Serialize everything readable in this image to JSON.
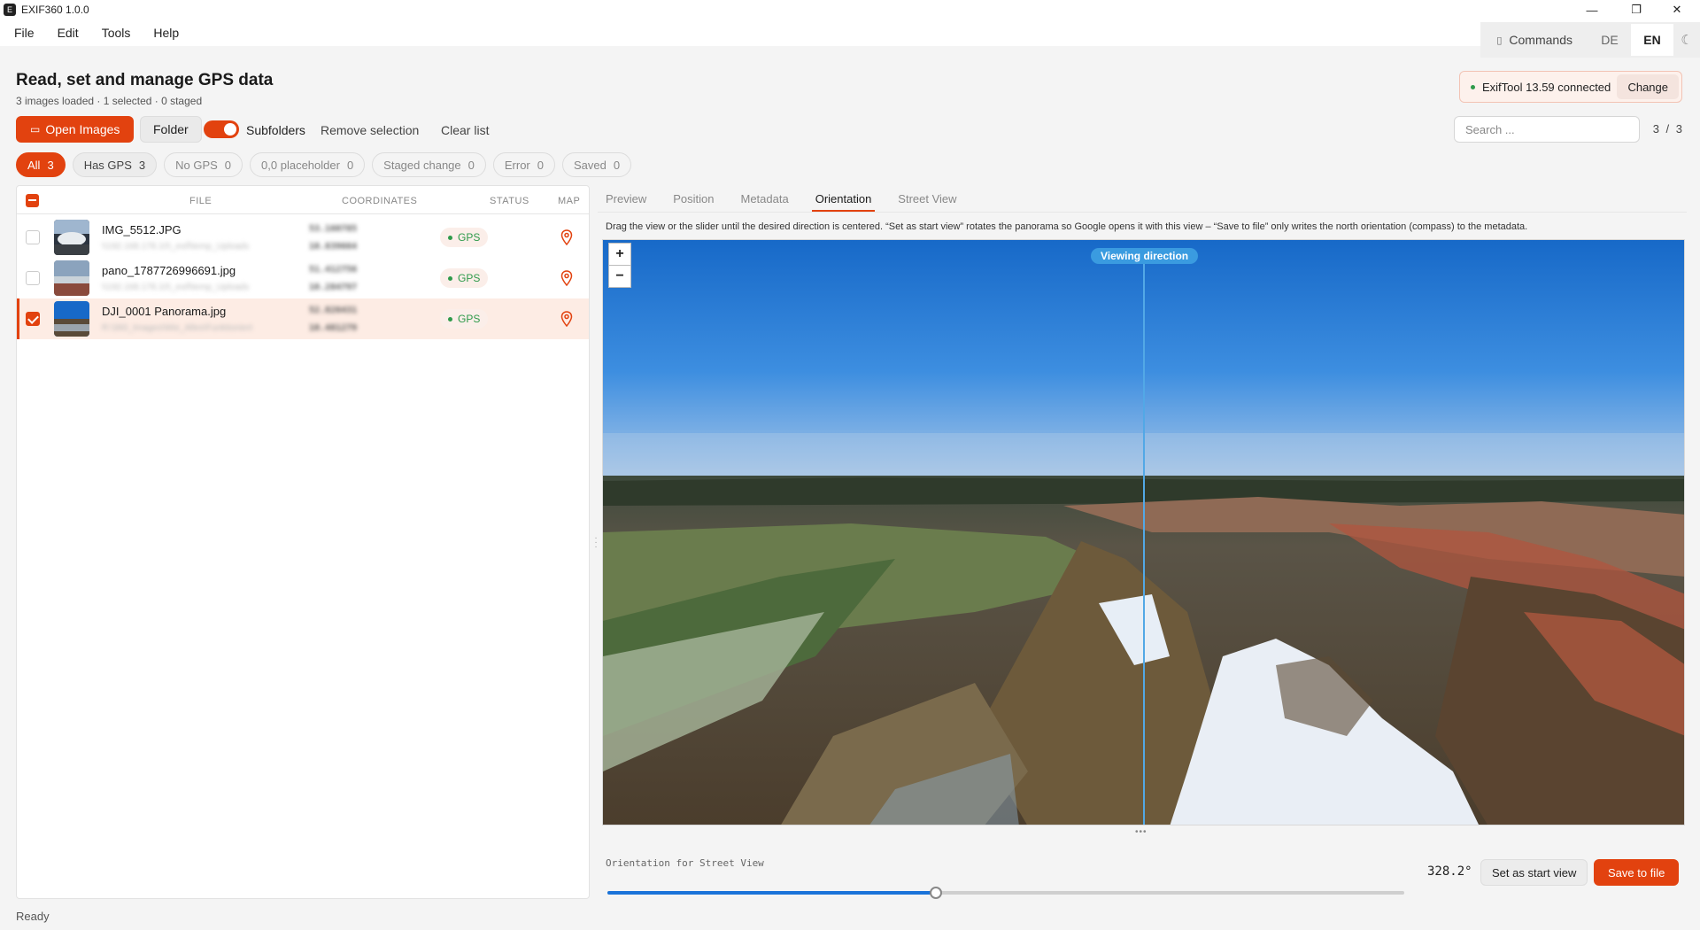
{
  "window": {
    "title": "EXIF360 1.0.0",
    "icon_glyph": "E",
    "minimize": "—",
    "restore": "❐",
    "close": "✕"
  },
  "menu": [
    "File",
    "Edit",
    "Tools",
    "Help"
  ],
  "topbar": {
    "commands_icon": "▯",
    "commands": "Commands",
    "lang_de": "DE",
    "lang_en": "EN",
    "theme_icon": "☾"
  },
  "header": {
    "title": "Read, set and manage GPS data",
    "subtitle": "3 images loaded · 1 selected · 0 staged"
  },
  "exiftool": {
    "status": "ExifTool 13.59 connected",
    "change": "Change"
  },
  "toolbar": {
    "open_images_icon": "▭",
    "open_images": "Open Images",
    "folder": "Folder",
    "subfolders": "Subfolders",
    "subfolders_on": true,
    "remove_selection": "Remove selection",
    "clear_list": "Clear list",
    "search_placeholder": "Search ...",
    "pager": "3 / 3"
  },
  "filters": [
    {
      "label": "All",
      "count": "3",
      "state": "active"
    },
    {
      "label": "Has GPS",
      "count": "3",
      "state": "has"
    },
    {
      "label": "No GPS",
      "count": "0",
      "state": ""
    },
    {
      "label": "0,0 placeholder",
      "count": "0",
      "state": ""
    },
    {
      "label": "Staged change",
      "count": "0",
      "state": ""
    },
    {
      "label": "Error",
      "count": "0",
      "state": ""
    },
    {
      "label": "Saved",
      "count": "0",
      "state": ""
    }
  ],
  "table": {
    "columns": {
      "file": "FILE",
      "coordinates": "COORDINATES",
      "status": "STATUS",
      "map": "MAP"
    },
    "rows": [
      {
        "name": "IMG_5512.JPG",
        "path": "\\\\192.168.178.10\\_exif\\temp_Uploads",
        "lat": "53.160785",
        "lon": "10.839664",
        "status": "GPS",
        "selected": false
      },
      {
        "name": "pano_1787726996691.jpg",
        "path": "\\\\192.168.178.10\\_exif\\temp_Uploads",
        "lat": "51.412756",
        "lon": "10.284797",
        "status": "GPS",
        "selected": false
      },
      {
        "name": "DJI_0001 Panorama.jpg",
        "path": "R:\\360_Images\\Wie_Alles\\Funktioniert",
        "lat": "52.826431",
        "lon": "10.481279",
        "status": "GPS",
        "selected": true
      }
    ]
  },
  "tabs": [
    {
      "label": "Preview",
      "active": false
    },
    {
      "label": "Position",
      "active": false
    },
    {
      "label": "Metadata",
      "active": false
    },
    {
      "label": "Orientation",
      "active": true
    },
    {
      "label": "Street View",
      "active": false
    }
  ],
  "orientation": {
    "hint": "Drag the view or the slider until the desired direction is centered. “Set as start view” rotates the panorama so Google opens it with this view – “Save to file” only writes the north orientation (compass) to the metadata.",
    "viewing_direction": "Viewing direction",
    "zoom_in": "+",
    "zoom_out": "−",
    "slider_label": "Orientation for Street View",
    "degrees": "328.2°",
    "slider_fraction": 0.412,
    "set_start": "Set as start view",
    "save": "Save to file"
  },
  "status": "Ready",
  "colors": {
    "accent": "#e2420f",
    "gps_green": "#2e9a4a",
    "slider_blue": "#1a73d9",
    "direction_blue": "#3a9be0"
  }
}
